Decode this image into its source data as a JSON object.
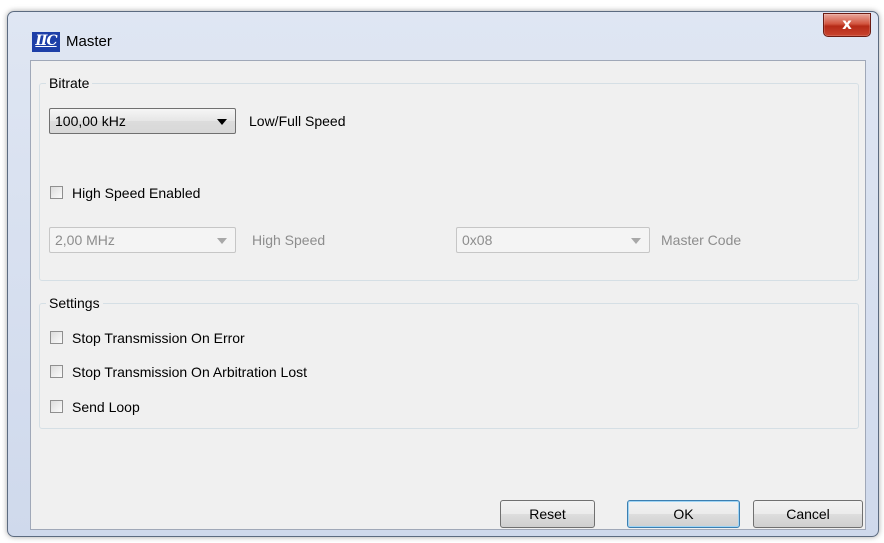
{
  "window": {
    "title": "Master",
    "app_icon_text": "IIC",
    "close_symbol": "x"
  },
  "bitrate": {
    "group_label": "Bitrate",
    "speed_select": {
      "value": "100,00 kHz"
    },
    "speed_label": "Low/Full Speed",
    "high_speed_checkbox": {
      "label": "High Speed Enabled",
      "checked": false
    },
    "high_speed_select": {
      "value": "2,00 MHz",
      "enabled": false
    },
    "high_speed_label": "High Speed",
    "master_code_select": {
      "value": "0x08",
      "enabled": false
    },
    "master_code_label": "Master Code"
  },
  "settings": {
    "group_label": "Settings",
    "items": [
      {
        "label": "Stop Transmission On Error",
        "checked": false
      },
      {
        "label": "Stop Transmission On Arbitration Lost",
        "checked": false
      },
      {
        "label": "Send Loop",
        "checked": false
      }
    ]
  },
  "buttons": {
    "reset": "Reset",
    "ok": "OK",
    "cancel": "Cancel"
  },
  "colors": {
    "titlebar": "#cfd9ec",
    "close_button": "#c9452f",
    "client_bg": "#f0f0f0",
    "default_button_border": "#3c7fb1"
  }
}
